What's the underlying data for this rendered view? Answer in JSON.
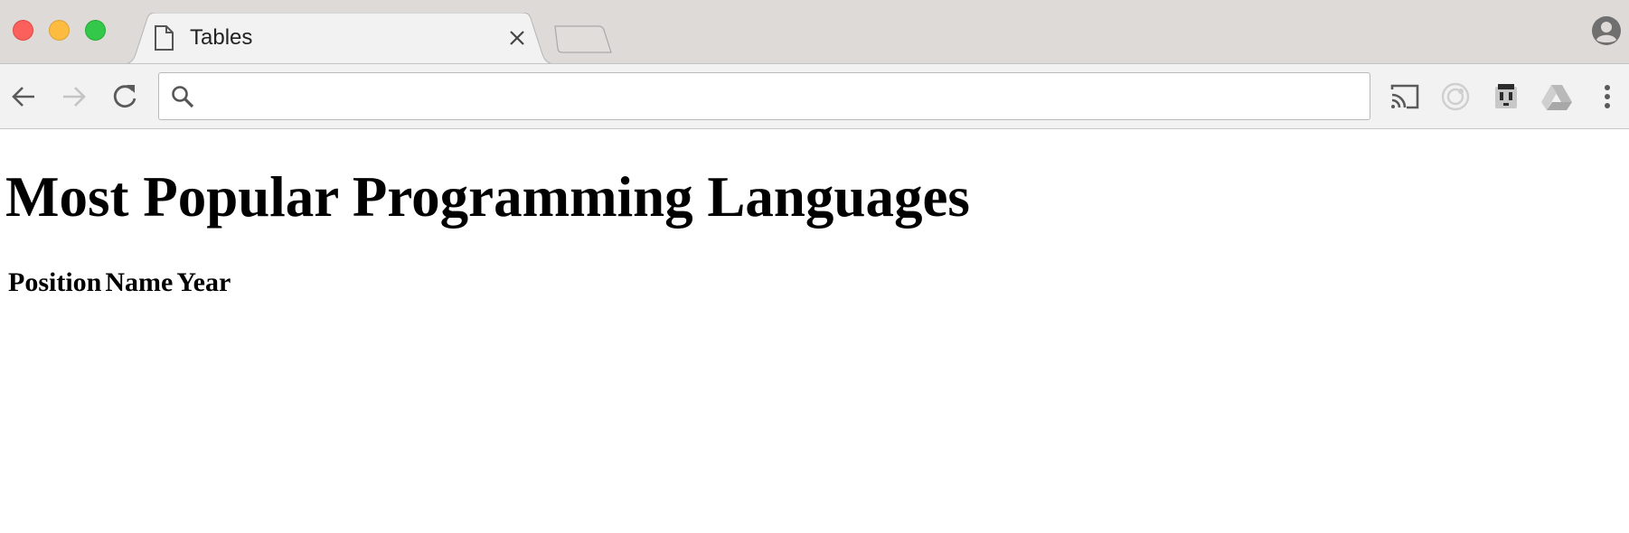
{
  "browser": {
    "tab": {
      "title": "Tables"
    },
    "address_bar": {
      "value": "",
      "placeholder": ""
    },
    "icons": {
      "tab": "document-icon",
      "tab_close": "close-icon",
      "back": "back-arrow-icon",
      "forward": "forward-arrow-icon",
      "reload": "reload-icon",
      "search": "search-icon",
      "cast": "cast-icon",
      "ring": "target-ring-icon",
      "plug": "plug-icon",
      "drive": "drive-icon",
      "menu": "more-vertical-icon",
      "profile": "profile-icon"
    }
  },
  "page": {
    "heading": "Most Popular Programming Languages",
    "table": {
      "headers": [
        "Position",
        "Name",
        "Year"
      ]
    }
  }
}
